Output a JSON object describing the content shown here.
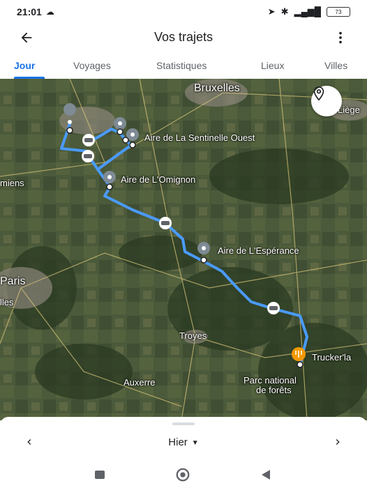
{
  "status_bar": {
    "time": "21:01",
    "battery": "73"
  },
  "app_bar": {
    "title": "Vos trajets"
  },
  "tabs": [
    {
      "label": "Jour",
      "active": true
    },
    {
      "label": "Voyages",
      "active": false
    },
    {
      "label": "Statistiques",
      "active": false
    },
    {
      "label": "Lieux",
      "active": false
    },
    {
      "label": "Villes",
      "active": false
    }
  ],
  "map": {
    "cities": [
      "Bruxelles",
      "Liège",
      "miens",
      "Paris",
      "lles",
      "Troyes",
      "Auxerre"
    ],
    "poi_labels": [
      "Aire de La Sentinelle Ouest",
      "Aire de L'Omignon",
      "Aire de L'Espérance",
      "Trucker'la"
    ],
    "park_label": [
      "Parc national",
      "de forêts"
    ],
    "route_color": "#4a9bff"
  },
  "bottom_sheet": {
    "date_label": "Hier"
  },
  "colors": {
    "accent": "#1a73e8",
    "place_marker": "#7e8a94",
    "food_marker": "#f29900"
  }
}
